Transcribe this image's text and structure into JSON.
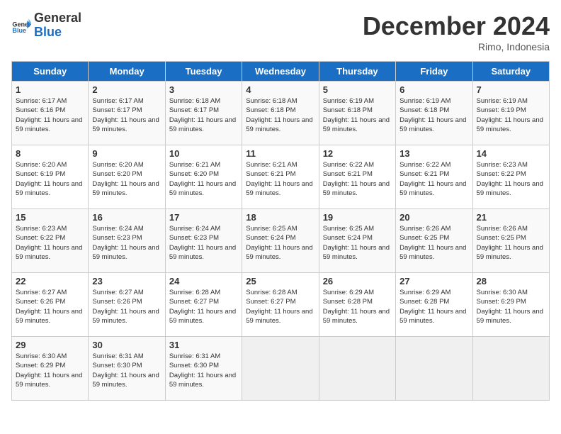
{
  "header": {
    "logo_general": "General",
    "logo_blue": "Blue",
    "month_title": "December 2024",
    "location": "Rimo, Indonesia"
  },
  "days_of_week": [
    "Sunday",
    "Monday",
    "Tuesday",
    "Wednesday",
    "Thursday",
    "Friday",
    "Saturday"
  ],
  "weeks": [
    [
      {
        "day": 1,
        "info": "Sunrise: 6:17 AM\nSunset: 6:16 PM\nDaylight: 11 hours\nand 59 minutes."
      },
      {
        "day": 2,
        "info": "Sunrise: 6:17 AM\nSunset: 6:17 PM\nDaylight: 11 hours\nand 59 minutes."
      },
      {
        "day": 3,
        "info": "Sunrise: 6:18 AM\nSunset: 6:17 PM\nDaylight: 11 hours\nand 59 minutes."
      },
      {
        "day": 4,
        "info": "Sunrise: 6:18 AM\nSunset: 6:18 PM\nDaylight: 11 hours\nand 59 minutes."
      },
      {
        "day": 5,
        "info": "Sunrise: 6:19 AM\nSunset: 6:18 PM\nDaylight: 11 hours\nand 59 minutes."
      },
      {
        "day": 6,
        "info": "Sunrise: 6:19 AM\nSunset: 6:18 PM\nDaylight: 11 hours\nand 59 minutes."
      },
      {
        "day": 7,
        "info": "Sunrise: 6:19 AM\nSunset: 6:19 PM\nDaylight: 11 hours\nand 59 minutes."
      }
    ],
    [
      {
        "day": 8,
        "info": "Sunrise: 6:20 AM\nSunset: 6:19 PM\nDaylight: 11 hours\nand 59 minutes."
      },
      {
        "day": 9,
        "info": "Sunrise: 6:20 AM\nSunset: 6:20 PM\nDaylight: 11 hours\nand 59 minutes."
      },
      {
        "day": 10,
        "info": "Sunrise: 6:21 AM\nSunset: 6:20 PM\nDaylight: 11 hours\nand 59 minutes."
      },
      {
        "day": 11,
        "info": "Sunrise: 6:21 AM\nSunset: 6:21 PM\nDaylight: 11 hours\nand 59 minutes."
      },
      {
        "day": 12,
        "info": "Sunrise: 6:22 AM\nSunset: 6:21 PM\nDaylight: 11 hours\nand 59 minutes."
      },
      {
        "day": 13,
        "info": "Sunrise: 6:22 AM\nSunset: 6:21 PM\nDaylight: 11 hours\nand 59 minutes."
      },
      {
        "day": 14,
        "info": "Sunrise: 6:23 AM\nSunset: 6:22 PM\nDaylight: 11 hours\nand 59 minutes."
      }
    ],
    [
      {
        "day": 15,
        "info": "Sunrise: 6:23 AM\nSunset: 6:22 PM\nDaylight: 11 hours\nand 59 minutes."
      },
      {
        "day": 16,
        "info": "Sunrise: 6:24 AM\nSunset: 6:23 PM\nDaylight: 11 hours\nand 59 minutes."
      },
      {
        "day": 17,
        "info": "Sunrise: 6:24 AM\nSunset: 6:23 PM\nDaylight: 11 hours\nand 59 minutes."
      },
      {
        "day": 18,
        "info": "Sunrise: 6:25 AM\nSunset: 6:24 PM\nDaylight: 11 hours\nand 59 minutes."
      },
      {
        "day": 19,
        "info": "Sunrise: 6:25 AM\nSunset: 6:24 PM\nDaylight: 11 hours\nand 59 minutes."
      },
      {
        "day": 20,
        "info": "Sunrise: 6:26 AM\nSunset: 6:25 PM\nDaylight: 11 hours\nand 59 minutes."
      },
      {
        "day": 21,
        "info": "Sunrise: 6:26 AM\nSunset: 6:25 PM\nDaylight: 11 hours\nand 59 minutes."
      }
    ],
    [
      {
        "day": 22,
        "info": "Sunrise: 6:27 AM\nSunset: 6:26 PM\nDaylight: 11 hours\nand 59 minutes."
      },
      {
        "day": 23,
        "info": "Sunrise: 6:27 AM\nSunset: 6:26 PM\nDaylight: 11 hours\nand 59 minutes."
      },
      {
        "day": 24,
        "info": "Sunrise: 6:28 AM\nSunset: 6:27 PM\nDaylight: 11 hours\nand 59 minutes."
      },
      {
        "day": 25,
        "info": "Sunrise: 6:28 AM\nSunset: 6:27 PM\nDaylight: 11 hours\nand 59 minutes."
      },
      {
        "day": 26,
        "info": "Sunrise: 6:29 AM\nSunset: 6:28 PM\nDaylight: 11 hours\nand 59 minutes."
      },
      {
        "day": 27,
        "info": "Sunrise: 6:29 AM\nSunset: 6:28 PM\nDaylight: 11 hours\nand 59 minutes."
      },
      {
        "day": 28,
        "info": "Sunrise: 6:30 AM\nSunset: 6:29 PM\nDaylight: 11 hours\nand 59 minutes."
      }
    ],
    [
      {
        "day": 29,
        "info": "Sunrise: 6:30 AM\nSunset: 6:29 PM\nDaylight: 11 hours\nand 59 minutes."
      },
      {
        "day": 30,
        "info": "Sunrise: 6:31 AM\nSunset: 6:30 PM\nDaylight: 11 hours\nand 59 minutes."
      },
      {
        "day": 31,
        "info": "Sunrise: 6:31 AM\nSunset: 6:30 PM\nDaylight: 11 hours\nand 59 minutes."
      },
      {
        "day": null
      },
      {
        "day": null
      },
      {
        "day": null
      },
      {
        "day": null
      }
    ]
  ]
}
